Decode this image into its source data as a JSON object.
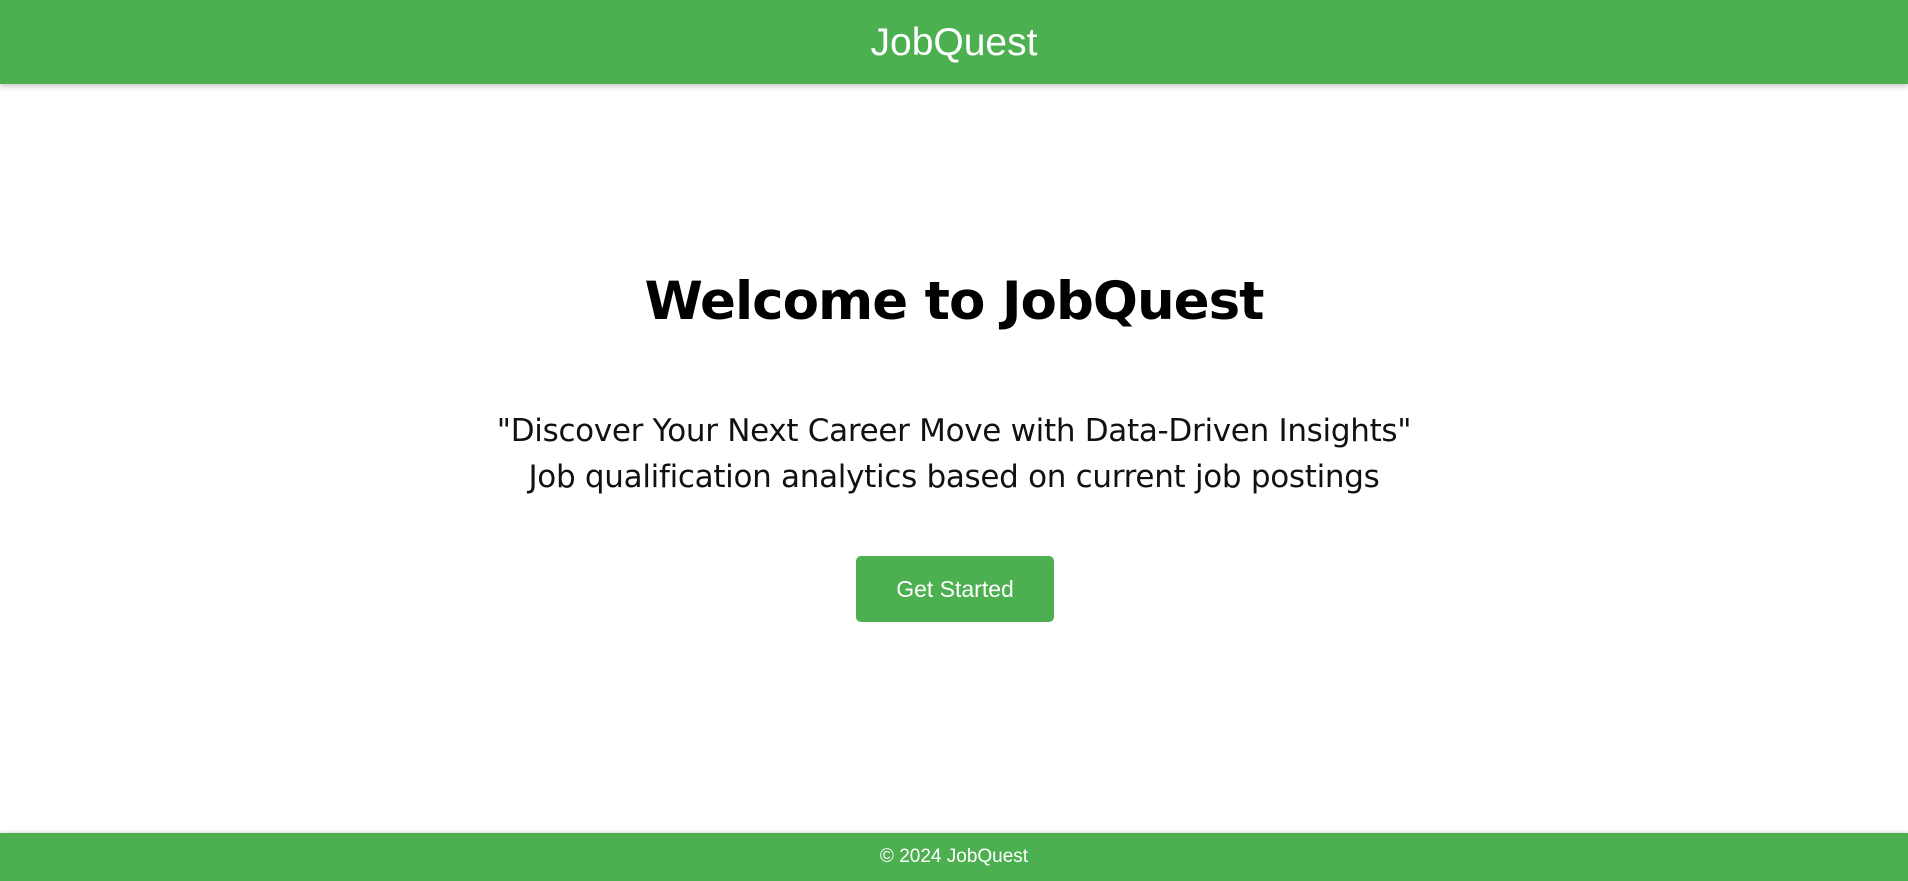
{
  "header": {
    "title": "JobQuest"
  },
  "hero": {
    "heading": "Welcome to JobQuest",
    "tagline_line1": "\"Discover Your Next Career Move with Data-Driven Insights\"",
    "tagline_line2": "Job qualification analytics based on current job postings",
    "cta_label": "Get Started"
  },
  "footer": {
    "copyright": "© 2024 JobQuest"
  },
  "colors": {
    "brand_green": "#4caf50",
    "background": "#ffffff",
    "text": "#000000"
  }
}
